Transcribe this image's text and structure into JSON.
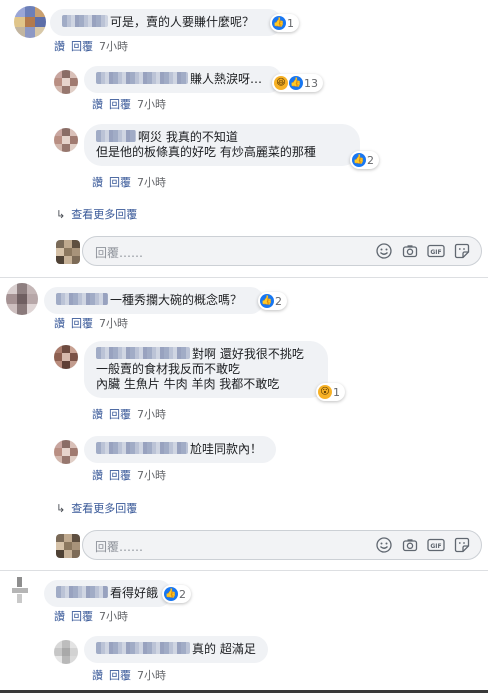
{
  "action_labels": {
    "like": "讚",
    "reply": "回覆"
  },
  "comments": [
    {
      "id": "c1",
      "text": "可是，賣的人要賺什麼呢？",
      "reaction_count": "1",
      "time": "7小時",
      "replies": [
        {
          "text": "賺人熱淚呀…",
          "reaction_count": "13",
          "time": "7小時"
        },
        {
          "text_line1": "啊災 我真的不知道",
          "text_line2": "但是他的板條真的好吃 有炒高麗菜的那種",
          "reaction_count": "2",
          "time": "7小時"
        }
      ],
      "more_replies": "查看更多回覆",
      "reply_placeholder": "回覆……"
    },
    {
      "id": "c2",
      "text": "一種秀攔大碗的概念嗎？",
      "reaction_count": "2",
      "time": "7小時",
      "replies": [
        {
          "text_line1": "對啊 還好我很不挑吃",
          "text_line2": "一般賣的食材我反而不敢吃",
          "text_line3": "內臟 生魚片 牛肉 羊肉 我都不敢吃",
          "reaction_count": "1",
          "time": "7小時"
        },
        {
          "text": "尬哇同款內！",
          "time": "7小時"
        }
      ],
      "more_replies": "查看更多回覆",
      "reply_placeholder": "回覆……"
    },
    {
      "id": "c3",
      "text": "看得好餓",
      "reaction_count": "2",
      "time": "7小時",
      "replies": [
        {
          "text": "真的 超滿足",
          "time": "7小時"
        }
      ]
    }
  ],
  "icons": {
    "arrow": "reply-arrow-icon",
    "emoji": "emoji-icon",
    "camera": "camera-icon",
    "gif": "gif-icon",
    "sticker": "sticker-icon"
  },
  "colors": {
    "link": "#385898",
    "bubble": "#f0f2f5",
    "like": "#1877f2"
  }
}
